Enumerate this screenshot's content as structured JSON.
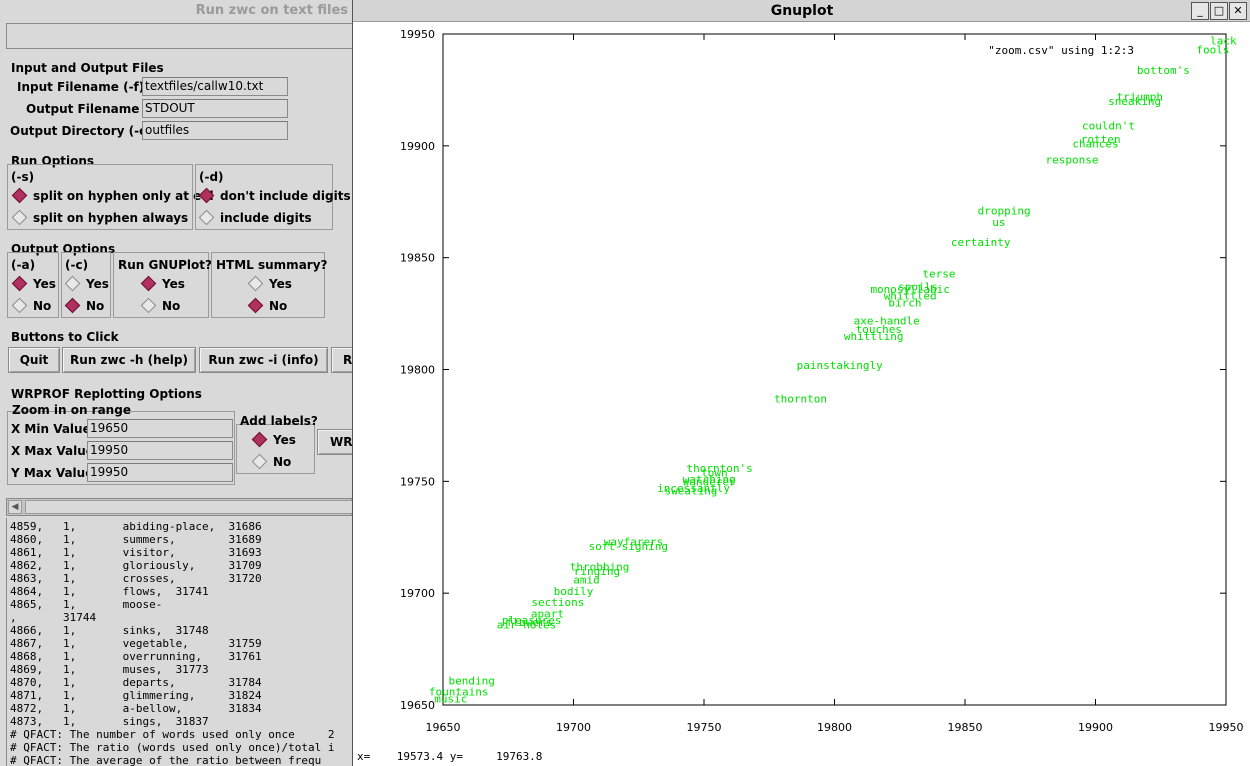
{
  "left_window": {
    "title": "Run zwc on text files",
    "io": {
      "section": "Input and Output Files",
      "input_label": "Input Filename (-f)",
      "input_value": "textfiles/callw10.txt",
      "output_label": "Output Filename",
      "output_value": "STDOUT",
      "dir_label": "Output Directory (-o)",
      "dir_value": "outfiles"
    },
    "run_options": {
      "section": "Run Options",
      "s_label": "(-s)",
      "s_opt1": "split on hyphen only at eol",
      "s_opt2": "split on hyphen always",
      "d_label": "(-d)",
      "d_opt1": "don't include digits",
      "d_opt2": "include digits"
    },
    "output_options": {
      "section": "Output Options",
      "a_label": "(-a)",
      "c_label": "(-c)",
      "gnuplot_label": "Run GNUPlot?",
      "html_label": "HTML summary?",
      "yes": "Yes",
      "no": "No"
    },
    "buttons": {
      "section": "Buttons to Click",
      "quit": "Quit",
      "help": "Run zwc -h (help)",
      "info": "Run zwc -i (info)",
      "partial": "R"
    },
    "wrprof": {
      "section": "WRPROF Replotting Options",
      "zoom_label": "Zoom in on range",
      "xmin_label": "X Min Value",
      "xmin_value": "19650",
      "xmax_label": "X Max Value",
      "xmax_value": "19950",
      "ymax_label": "Y Max Value",
      "ymax_value": "19950",
      "labels_label": "Add labels?",
      "yes": "Yes",
      "no": "No",
      "partial_btn": "WR"
    },
    "output_lines": [
      "4859,   1,       abiding-place,  31686",
      "4860,   1,       summers,        31689",
      "4861,   1,       visitor,        31693",
      "4862,   1,       gloriously,     31709",
      "4863,   1,       crosses,        31720",
      "4864,   1,       flows,  31741",
      "4865,   1,       moose-",
      ",       31744",
      "4866,   1,       sinks,  31748",
      "4867,   1,       vegetable,      31759",
      "4868,   1,       overrunning,    31761",
      "4869,   1,       muses,  31773",
      "4870,   1,       departs,        31784",
      "4871,   1,       glimmering,     31824",
      "4872,   1,       a-bellow,       31834",
      "4873,   1,       sings,  31837",
      "# QFACT: The number of words used only once     2",
      "# QFACT: The ratio (words used only once)/total i",
      "# QFACT: The average of the ratio between frequ"
    ]
  },
  "gnuplot": {
    "title": "Gnuplot",
    "status": "x=    19573.4 y=     19763.8",
    "colors": {
      "label": "#00e000",
      "axis": "#000000"
    }
  },
  "chart_data": {
    "type": "scatter",
    "legend": "\"zoom.csv\" using 1:2:3",
    "xlim": [
      19650,
      19950
    ],
    "ylim": [
      19650,
      19950
    ],
    "xticks": [
      19650,
      19700,
      19750,
      19800,
      19850,
      19900,
      19950
    ],
    "yticks": [
      19650,
      19700,
      19750,
      19800,
      19850,
      19900,
      19950
    ],
    "points": [
      {
        "label": "lack",
        "x": 19949,
        "y": 19947
      },
      {
        "label": "fools",
        "x": 19945,
        "y": 19943
      },
      {
        "label": "bottom's",
        "x": 19926,
        "y": 19934
      },
      {
        "label": "triumph",
        "x": 19917,
        "y": 19922
      },
      {
        "label": "sneaking",
        "x": 19915,
        "y": 19920
      },
      {
        "label": "couldn't",
        "x": 19905,
        "y": 19909
      },
      {
        "label": "rotten",
        "x": 19902,
        "y": 19903
      },
      {
        "label": "chances",
        "x": 19900,
        "y": 19901
      },
      {
        "label": "response",
        "x": 19891,
        "y": 19894
      },
      {
        "label": "dropping",
        "x": 19865,
        "y": 19871
      },
      {
        "label": "us",
        "x": 19863,
        "y": 19866
      },
      {
        "label": "certainty",
        "x": 19856,
        "y": 19857
      },
      {
        "label": "terse",
        "x": 19840,
        "y": 19843
      },
      {
        "label": "monosyllabic",
        "x": 19829,
        "y": 19836
      },
      {
        "label": "spoils",
        "x": 19832,
        "y": 19837
      },
      {
        "label": "whittled",
        "x": 19829,
        "y": 19833
      },
      {
        "label": "birch",
        "x": 19827,
        "y": 19830
      },
      {
        "label": "axe-handle",
        "x": 19820,
        "y": 19822
      },
      {
        "label": "touches",
        "x": 19817,
        "y": 19818
      },
      {
        "label": "whittling",
        "x": 19815,
        "y": 19815
      },
      {
        "label": "painstakingly",
        "x": 19802,
        "y": 19802
      },
      {
        "label": "thornton",
        "x": 19787,
        "y": 19787
      },
      {
        "label": "thornton's",
        "x": 19756,
        "y": 19756
      },
      {
        "label": "town",
        "x": 19754,
        "y": 19754
      },
      {
        "label": "watching",
        "x": 19752,
        "y": 19751
      },
      {
        "label": "wanderer",
        "x": 19752,
        "y": 19750
      },
      {
        "label": "incessantly",
        "x": 19746,
        "y": 19747
      },
      {
        "label": "sweating",
        "x": 19745,
        "y": 19746
      },
      {
        "label": "wayfarers",
        "x": 19723,
        "y": 19723
      },
      {
        "label": "soft-sighing",
        "x": 19721,
        "y": 19721
      },
      {
        "label": "throbbing",
        "x": 19710,
        "y": 19712
      },
      {
        "label": "ringing",
        "x": 19709,
        "y": 19710
      },
      {
        "label": "amid",
        "x": 19705,
        "y": 19706
      },
      {
        "label": "bodily",
        "x": 19700,
        "y": 19701
      },
      {
        "label": "sections",
        "x": 19694,
        "y": 19696
      },
      {
        "label": "apart",
        "x": 19690,
        "y": 19691
      },
      {
        "label": "pleasures",
        "x": 19684,
        "y": 19688
      },
      {
        "label": "flowers",
        "x": 19683,
        "y": 19687
      },
      {
        "label": "air-holes",
        "x": 19682,
        "y": 19686
      },
      {
        "label": "bending",
        "x": 19661,
        "y": 19661
      },
      {
        "label": "fountains",
        "x": 19656,
        "y": 19656
      },
      {
        "label": "music",
        "x": 19653,
        "y": 19653
      }
    ]
  }
}
